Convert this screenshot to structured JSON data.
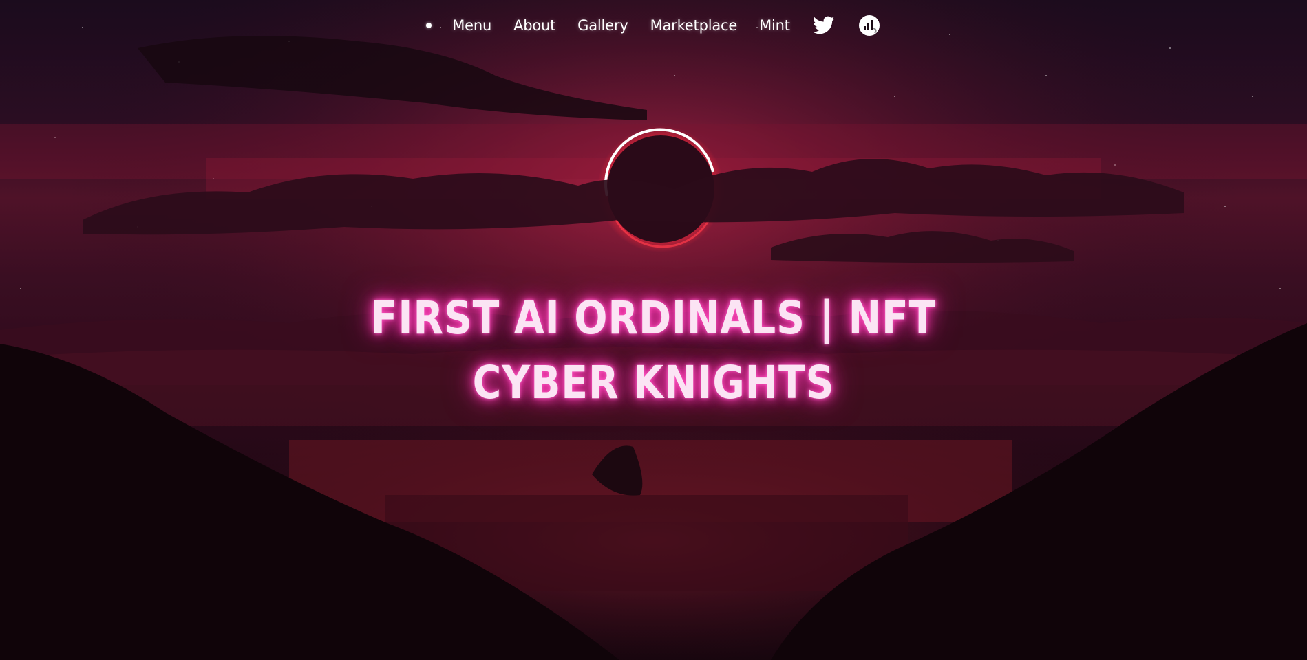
{
  "nav": {
    "items": [
      {
        "label": "Menu"
      },
      {
        "label": "About"
      },
      {
        "label": "Gallery"
      },
      {
        "label": "Marketplace"
      },
      {
        "label": "Mint"
      }
    ],
    "icons": [
      {
        "name": "twitter-icon"
      },
      {
        "name": "marketplace-logo-icon"
      }
    ]
  },
  "hero": {
    "line1": "FIRST AI ORDINALS | NFT",
    "line2": "CYBER KNIGHTS"
  },
  "colors": {
    "accent_glow": "#ff3cb4",
    "headline_text": "#fbe4f4",
    "sky_top": "#1b0b1e",
    "sky_mid": "#4a0f25",
    "eclipse_ring": "#ffffff"
  }
}
